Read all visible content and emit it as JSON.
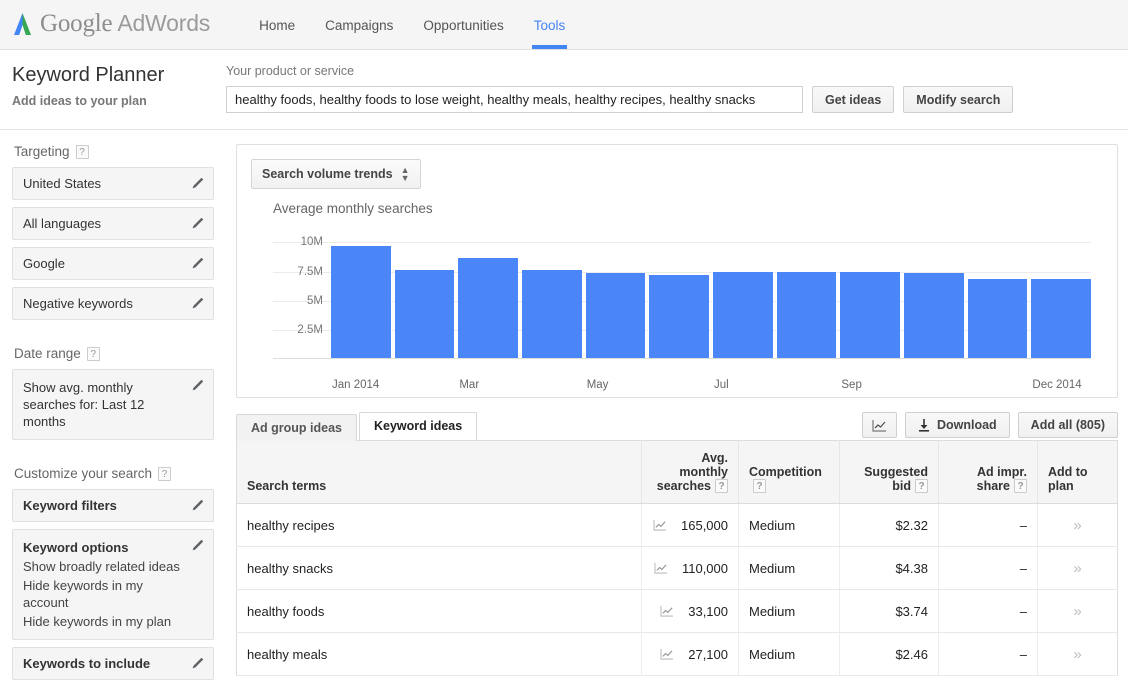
{
  "topnav": {
    "logo_text_google": "Google",
    "logo_text_adwords": "AdWords",
    "items": [
      {
        "label": "Home",
        "active": false
      },
      {
        "label": "Campaigns",
        "active": false
      },
      {
        "label": "Opportunities",
        "active": false
      },
      {
        "label": "Tools",
        "active": true
      }
    ]
  },
  "header": {
    "title": "Keyword Planner",
    "subtitle": "Add ideas to your plan",
    "search_label": "Your product or service",
    "search_value": "healthy foods, healthy foods to lose weight, healthy meals, healthy recipes, healthy snacks",
    "get_ideas_label": "Get ideas",
    "modify_search_label": "Modify search"
  },
  "sidebar": {
    "targeting_heading": "Targeting",
    "targeting_items": [
      {
        "label": "United States"
      },
      {
        "label": "All languages"
      },
      {
        "label": "Google"
      },
      {
        "label": "Negative keywords"
      }
    ],
    "date_range_heading": "Date range",
    "date_range_value": "Show avg. monthly searches for: Last 12 months",
    "customize_heading": "Customize your search",
    "keyword_filters_label": "Keyword filters",
    "keyword_options_label": "Keyword options",
    "keyword_options_items": [
      "Show broadly related ideas",
      "Hide keywords in my account",
      "Hide keywords in my plan"
    ],
    "keywords_to_include_label": "Keywords to include",
    "help_glyph": "?"
  },
  "chart_panel": {
    "dropdown_label": "Search volume trends"
  },
  "chart_data": {
    "type": "bar",
    "title": "Average monthly searches",
    "xlabel": "",
    "ylabel": "",
    "categories": [
      "Jan 2014",
      "Feb",
      "Mar",
      "Apr",
      "May",
      "Jun",
      "Jul",
      "Aug",
      "Sep",
      "Oct",
      "Nov",
      "Dec 2014"
    ],
    "tick_labels": [
      "Jan 2014",
      "",
      "Mar",
      "",
      "May",
      "",
      "Jul",
      "",
      "Sep",
      "",
      "",
      "Dec 2014"
    ],
    "values": [
      9700000,
      7600000,
      8700000,
      7600000,
      7400000,
      7200000,
      7500000,
      7500000,
      7500000,
      7400000,
      6900000,
      6900000
    ],
    "yticks": [
      2500000,
      5000000,
      7500000,
      10000000
    ],
    "ytick_labels": [
      "2.5M",
      "5M",
      "7.5M",
      "10M"
    ],
    "ylim": [
      0,
      10800000
    ],
    "grid": true,
    "legend": "none",
    "bar_color": "#4a86f7"
  },
  "tabs": {
    "items": [
      {
        "label": "Ad group ideas",
        "active": false
      },
      {
        "label": "Keyword ideas",
        "active": true
      }
    ],
    "graph_button_label": "",
    "download_label": "Download",
    "add_all_label": "Add all (805)"
  },
  "table": {
    "columns": [
      {
        "label": "Search terms",
        "help": false
      },
      {
        "label": "Avg. monthly searches",
        "help": true
      },
      {
        "label": "Competition",
        "help": true
      },
      {
        "label": "Suggested bid",
        "help": true
      },
      {
        "label": "Ad impr. share",
        "help": true
      },
      {
        "label": "Add to plan",
        "help": false
      }
    ],
    "help_glyph": "?",
    "add_glyph": "»",
    "rows": [
      {
        "term": "healthy recipes",
        "volume": "165,000",
        "competition": "Medium",
        "bid": "$2.32",
        "share": "–"
      },
      {
        "term": "healthy snacks",
        "volume": "110,000",
        "competition": "Medium",
        "bid": "$4.38",
        "share": "–"
      },
      {
        "term": "healthy foods",
        "volume": "33,100",
        "competition": "Medium",
        "bid": "$3.74",
        "share": "–"
      },
      {
        "term": "healthy meals",
        "volume": "27,100",
        "competition": "Medium",
        "bid": "$2.46",
        "share": "–"
      }
    ]
  }
}
